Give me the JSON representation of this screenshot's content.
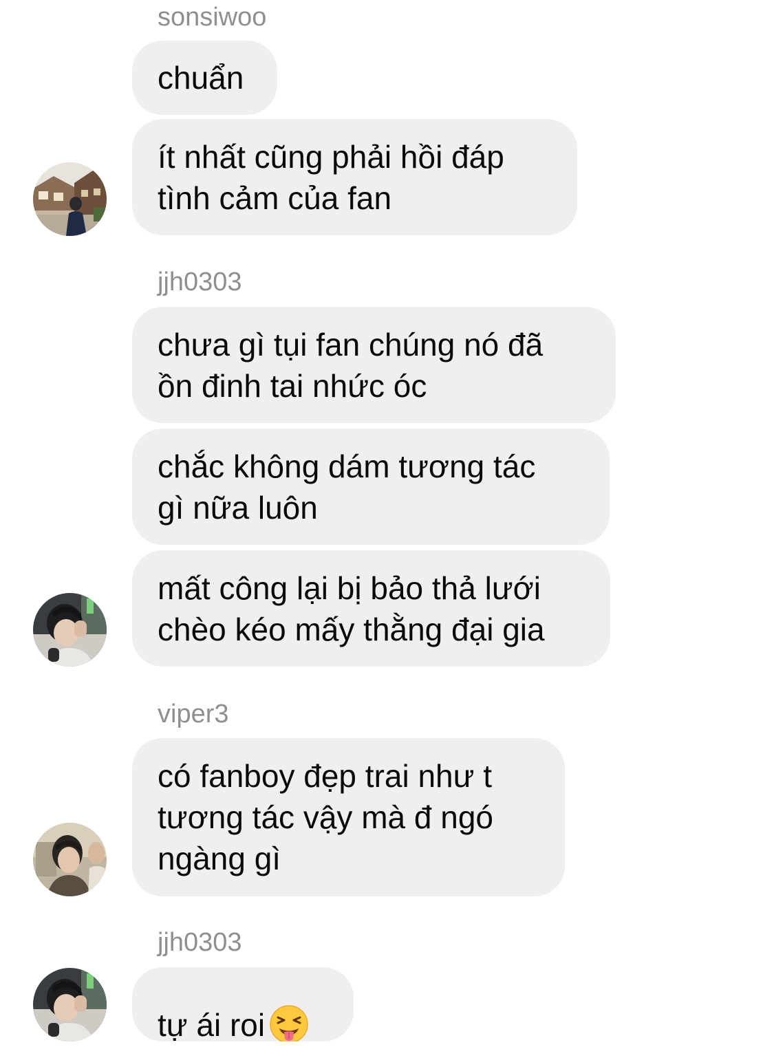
{
  "thread": {
    "groups": [
      {
        "sender": "sonsiwoo",
        "messages": [
          "chuẩn",
          "ít nhất cũng phải hồi đáp\ntình cảm của fan"
        ]
      },
      {
        "sender": "jjh0303",
        "messages": [
          "chưa gì tụi fan chúng nó đã\nồn đinh tai nhức óc",
          "chắc không dám tương tác\ngì nữa luôn",
          "mất công lại bị bảo thả lưới\nchèo kéo mấy thằng đại gia"
        ]
      },
      {
        "sender": "viper3",
        "messages": [
          "có fanboy đẹp trai như t\ntương tác vậy mà đ ngó\nngàng gì"
        ]
      },
      {
        "sender": "jjh0303",
        "messages": [
          "tự ái roi"
        ]
      }
    ]
  },
  "icons": {
    "last_message_emoji": "squinting-face-with-tongue-icon"
  },
  "colors": {
    "bubble_bg": "#efeff1",
    "sender_text": "#8e8e93",
    "message_text": "#0a0a0a"
  }
}
